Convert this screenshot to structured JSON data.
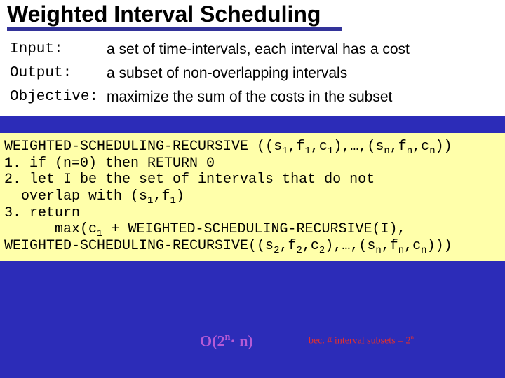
{
  "title": "Weighted Interval Scheduling",
  "defs": {
    "input_label": "Input:",
    "input_text": "a set of time-intervals, each interval has a cost",
    "output_label": "Output:",
    "output_text": "a subset of non-overlapping intervals",
    "objective_label": "Objective:",
    "objective_text": "maximize the sum of the costs in the subset"
  },
  "code": {
    "head_a": "WEIGHTED-SCHEDULING-RECURSIVE ((s",
    "head_b": ",f",
    "head_c": ",c",
    "head_d": "),…,(s",
    "head_e": ",f",
    "head_f": ",c",
    "head_g": "))",
    "l1": "1. if (n=0) then RETURN 0",
    "l2": "2. let I be the set of intervals that do not",
    "l2b_a": "  overlap with (s",
    "l2b_b": ",f",
    "l2b_c": ")",
    "l3": "3. return",
    "l3b_a": "      max(c",
    "l3b_b": " + WEIGHTED-SCHEDULING-RECURSIVE(I),",
    "l3c_a": "WEIGHTED-SCHEDULING-RECURSIVE((s",
    "l3c_b": ",f",
    "l3c_c": ",c",
    "l3c_d": "),…,(s",
    "l3c_e": ",f",
    "l3c_f": ",c",
    "l3c_g": ")))"
  },
  "sub": {
    "one": "1",
    "two": "2",
    "n": "n"
  },
  "annot": {
    "purple_a": "O(2",
    "purple_b": "· n)",
    "red_a": "bec. # interval subsets = 2"
  }
}
